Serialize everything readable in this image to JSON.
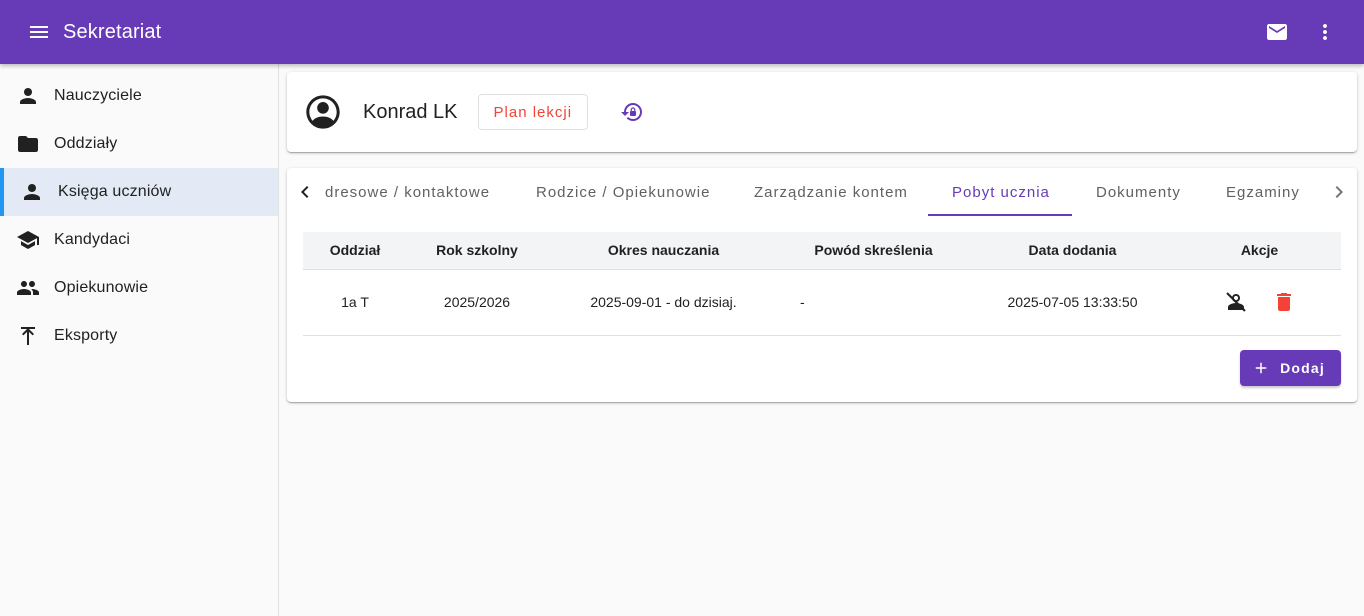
{
  "appbar": {
    "title": "Sekretariat",
    "menu_icon": "menu-icon",
    "mail_icon": "mail-icon",
    "more_icon": "more-vert-icon",
    "color": "#673ab7"
  },
  "sidebar": {
    "items": [
      {
        "label": "Nauczyciele",
        "icon": "person-icon"
      },
      {
        "label": "Oddziały",
        "icon": "folder-icon"
      },
      {
        "label": "Księga uczniów",
        "icon": "person-icon",
        "active": true
      },
      {
        "label": "Kandydaci",
        "icon": "school-icon"
      },
      {
        "label": "Opiekunowie",
        "icon": "people-icon"
      },
      {
        "label": "Eksporty",
        "icon": "upload-icon"
      }
    ]
  },
  "student": {
    "name": "Konrad LK",
    "plan_button": "Plan lekcji"
  },
  "tabs": {
    "items": [
      "dresowe / kontaktowe",
      "Rodzice / Opiekunowie",
      "Zarządzanie kontem",
      "Pobyt ucznia",
      "Dokumenty",
      "Egzaminy"
    ],
    "active_index": 3
  },
  "table": {
    "headers": [
      "Oddział",
      "Rok szkolny",
      "Okres nauczania",
      "Powód skreślenia",
      "Data dodania",
      "Akcje"
    ],
    "rows": [
      {
        "oddzial": "1a T",
        "rok": "2025/2026",
        "okres": "2025-09-01 - do dzisiaj.",
        "powod": "-",
        "data": "2025-07-05 13:33:50"
      }
    ]
  },
  "add_button": "Dodaj",
  "colors": {
    "primary": "#673ab7",
    "danger": "#f44336",
    "active_nav_bg": "#e3eaf5",
    "active_nav_bar": "#2196f3"
  }
}
